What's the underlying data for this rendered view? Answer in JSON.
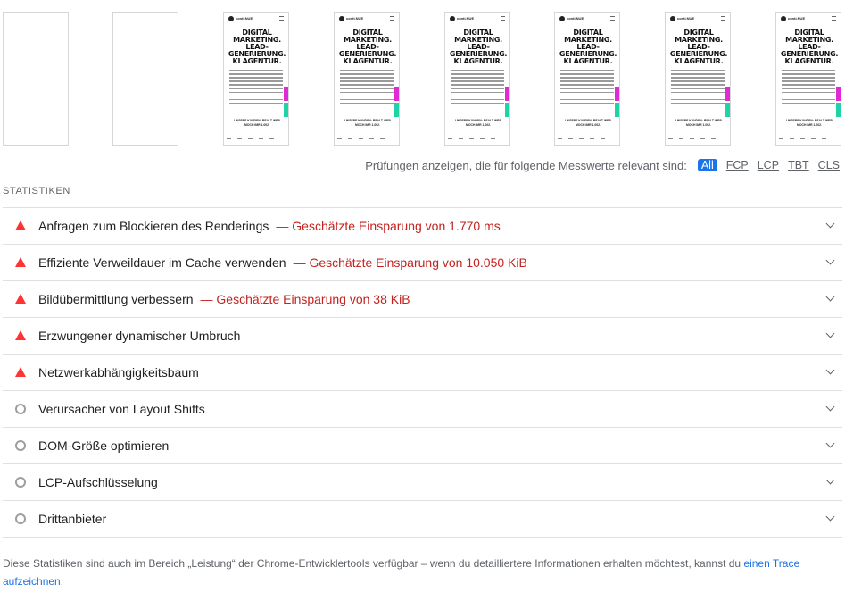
{
  "filmstrip": {
    "frames": [
      {
        "blank": true
      },
      {
        "blank": true
      },
      {
        "blank": false
      },
      {
        "blank": false
      },
      {
        "blank": false
      },
      {
        "blank": false
      },
      {
        "blank": false
      },
      {
        "blank": false
      }
    ],
    "logo_text": "conti.NUE",
    "headline": "DIGITAL MARKETING. LEAD-GENERIERUNG. KI AGENTUR.",
    "cta_text": "UNSERE KUNDEN: REALT WEB MOCH IMR 1.002."
  },
  "filter": {
    "label": "Prüfungen anzeigen, die für folgende Messwerte relevant sind:",
    "chips": [
      {
        "label": "All",
        "active": true
      },
      {
        "label": "FCP",
        "active": false
      },
      {
        "label": "LCP",
        "active": false
      },
      {
        "label": "TBT",
        "active": false
      },
      {
        "label": "CLS",
        "active": false
      }
    ]
  },
  "section": {
    "title": "STATISTIKEN"
  },
  "audits": [
    {
      "title": "Anfragen zum Blockieren des Renderings",
      "saving": "— Geschätzte Einsparung von 1.770 ms",
      "icon": "fail-triangle-icon"
    },
    {
      "title": "Effiziente Verweildauer im Cache verwenden",
      "saving": "— Geschätzte Einsparung von 10.050 KiB",
      "icon": "fail-triangle-icon"
    },
    {
      "title": "Bildübermittlung verbessern",
      "saving": "— Geschätzte Einsparung von 38 KiB",
      "icon": "fail-triangle-icon"
    },
    {
      "title": "Erzwungener dynamischer Umbruch",
      "saving": "",
      "icon": "fail-triangle-icon"
    },
    {
      "title": "Netzwerkabhängigkeitsbaum",
      "saving": "",
      "icon": "fail-triangle-icon"
    },
    {
      "title": "Verursacher von Layout Shifts",
      "saving": "",
      "icon": "informative-circle-icon"
    },
    {
      "title": "DOM-Größe optimieren",
      "saving": "",
      "icon": "informative-circle-icon"
    },
    {
      "title": "LCP-Aufschlüsselung",
      "saving": "",
      "icon": "informative-circle-icon"
    },
    {
      "title": "Drittanbieter",
      "saving": "",
      "icon": "informative-circle-icon"
    }
  ],
  "footer": {
    "text": "Diese Statistiken sind auch im Bereich „Leistung“ der Chrome-Entwicklertools verfügbar – wenn du detailliertere Informationen erhalten möchtest, kannst du ",
    "link": "einen Trace aufzeichnen",
    "end": "."
  },
  "colors": {
    "fail": "#ff3333",
    "saving": "#c5221f",
    "accent": "#1a73e8",
    "neutral": "#9e9e9e"
  }
}
